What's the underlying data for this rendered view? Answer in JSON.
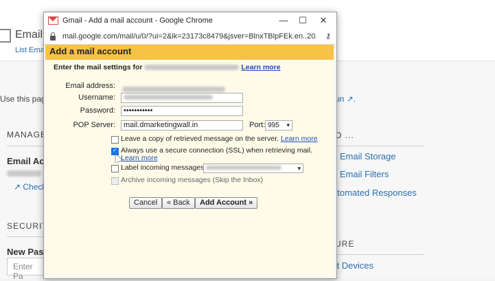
{
  "background": {
    "title": "Email",
    "subtitle": "List Ema",
    "use_text": "Use this pag",
    "right_link_fragment": "un",
    "manage_heading": "MANAGE",
    "email_account_label": "Email Acc",
    "check_link": "Check",
    "right_heading_1": "O ...",
    "right_links": [
      "p Email Storage",
      "e Email Filters",
      "utomated Responses"
    ],
    "security_heading": "SECURITY",
    "right_heading_2": "URE",
    "right_link_bottom": "ct Devices",
    "new_password_label": "New Pass",
    "new_password_placeholder": "Enter Pa"
  },
  "window": {
    "title": "Gmail - Add a mail account - Google Chrome",
    "url": "mail.google.com/mail/u/0/?ui=2&ik=23173c8479&jsver=BlnxTBlpFEk.en..20...",
    "icons": [
      "gmail-icon",
      "minimize-icon",
      "maximize-icon",
      "close-icon",
      "lock-icon",
      "key-icon"
    ]
  },
  "dialog": {
    "heading": "Add a mail account",
    "lead_text": "Enter the mail settings for",
    "lead_link": "Learn more",
    "fields": {
      "email_label": "Email address:",
      "username_label": "Username:",
      "password_label": "Password:",
      "password_value": "•••••••••••",
      "pop_label": "POP Server:",
      "pop_value": "mail.dmarketingwall.in",
      "port_label": "Port:",
      "port_value": "995"
    },
    "options": {
      "leave_copy": "Leave a copy of retrieved message on the server.",
      "leave_copy_link": "Learn more",
      "ssl": "Always use a secure connection (SSL) when retrieving mail.",
      "ssl_link": "Learn more",
      "label_incoming": "Label incoming messages:",
      "archive": "Archive incoming messages (Skip the Inbox)"
    },
    "buttons": {
      "cancel": "Cancel",
      "back": "« Back",
      "add": "Add Account »"
    }
  }
}
